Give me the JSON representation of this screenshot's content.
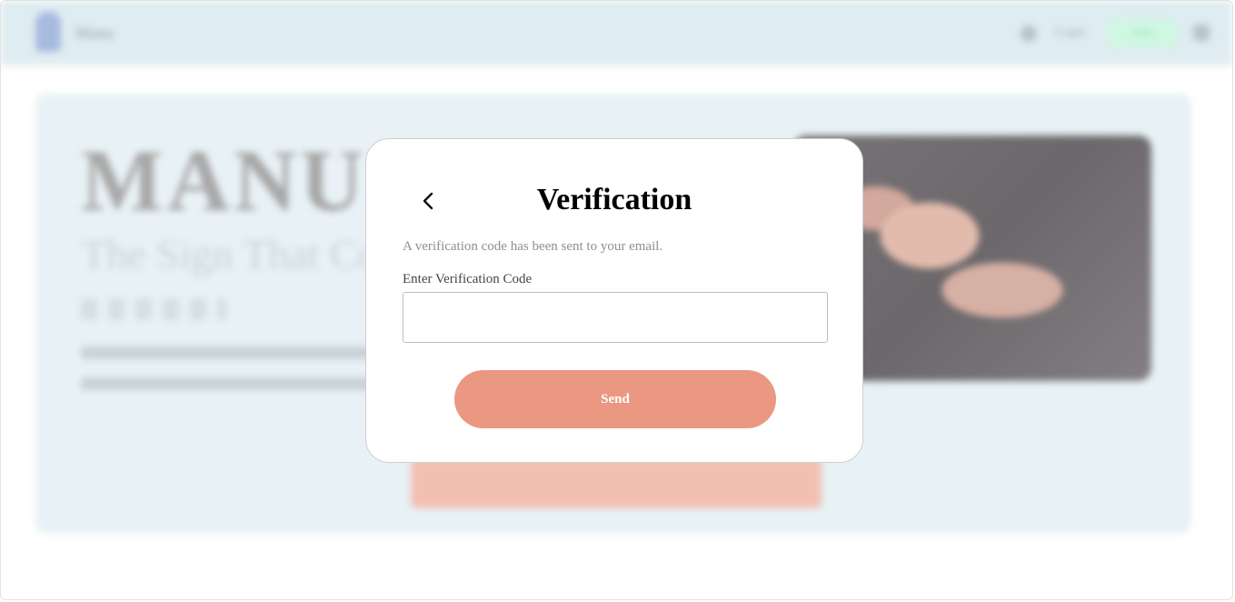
{
  "background": {
    "brand_name": "Manu",
    "nav": {
      "login_label": "Login",
      "signup_label": "Join"
    },
    "hero": {
      "title": "MANU",
      "subtitle": "The Sign That Connects"
    }
  },
  "modal": {
    "title": "Verification",
    "description": "A verification code has been sent to your email.",
    "code_label": "Enter Verification Code",
    "code_value": "",
    "code_placeholder": "",
    "send_label": "Send"
  },
  "colors": {
    "accent": "#ea9882",
    "topbar": "#d4e6ec",
    "hero_bg": "#e0edf2"
  },
  "icons": {
    "back": "chevron-left-icon"
  }
}
